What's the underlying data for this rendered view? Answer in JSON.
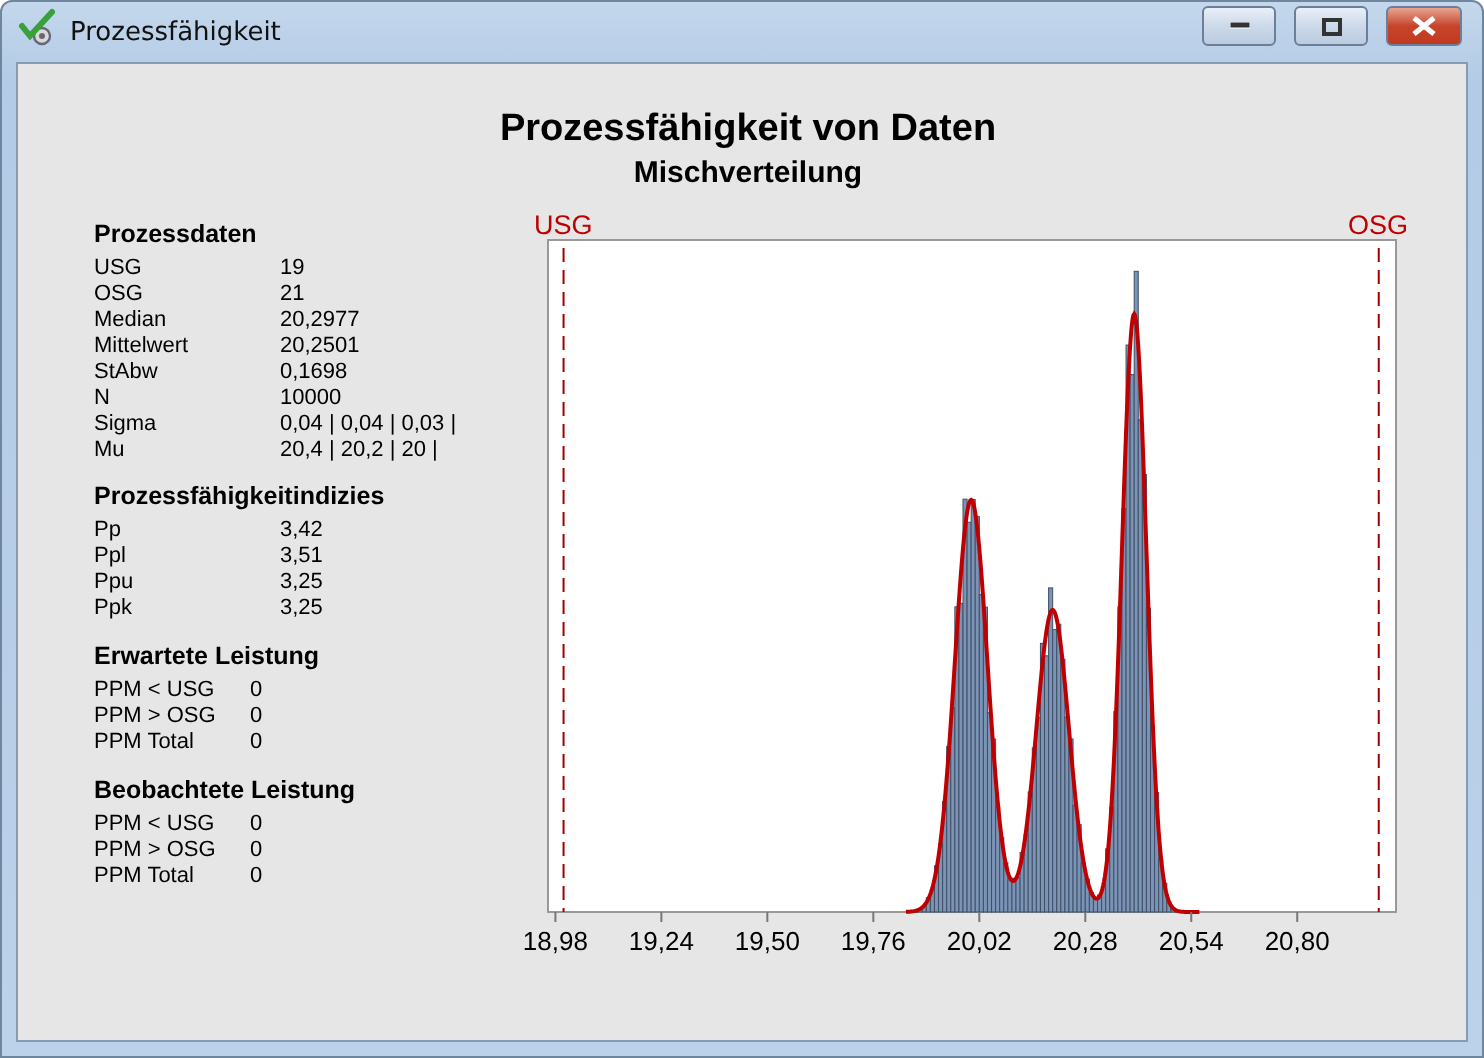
{
  "window": {
    "title": "Prozessfähigkeit"
  },
  "report": {
    "title": "Prozessfähigkeit von Daten",
    "subtitle": "Mischverteilung"
  },
  "sections": [
    {
      "heading": "Prozessdaten",
      "rows": [
        {
          "label": "USG",
          "value": "19"
        },
        {
          "label": "OSG",
          "value": "21"
        },
        {
          "label": "Median",
          "value": "20,2977"
        },
        {
          "label": "Mittelwert",
          "value": "20,2501"
        },
        {
          "label": "StAbw",
          "value": "0,1698"
        },
        {
          "label": "N",
          "value": "10000"
        },
        {
          "label": "Sigma",
          "value": "0,04 | 0,04 | 0,03 |"
        },
        {
          "label": "Mu",
          "value": "20,4 | 20,2 | 20 |"
        }
      ]
    },
    {
      "heading": "Prozessfähigkeitindizies",
      "rows": [
        {
          "label": "Pp",
          "value": "3,42"
        },
        {
          "label": "Ppl",
          "value": "3,51"
        },
        {
          "label": "Ppu",
          "value": "3,25"
        },
        {
          "label": "Ppk",
          "value": "3,25"
        }
      ]
    },
    {
      "heading": "Erwartete Leistung",
      "rows": [
        {
          "label": "PPM < USG",
          "value": "0"
        },
        {
          "label": "PPM > OSG",
          "value": "0"
        },
        {
          "label": "PPM Total",
          "value": "0"
        }
      ]
    },
    {
      "heading": "Beobachtete Leistung",
      "rows": [
        {
          "label": "PPM < USG",
          "value": "0"
        },
        {
          "label": "PPM > OSG",
          "value": "0"
        },
        {
          "label": "PPM Total",
          "value": "0"
        }
      ]
    }
  ],
  "histogram": {
    "lower_limit_label": "USG",
    "upper_limit_label": "OSG",
    "x_ticks": [
      "18,98",
      "19,24",
      "19,50",
      "19,76",
      "20,02",
      "20,28",
      "20,54",
      "20,80"
    ]
  }
}
